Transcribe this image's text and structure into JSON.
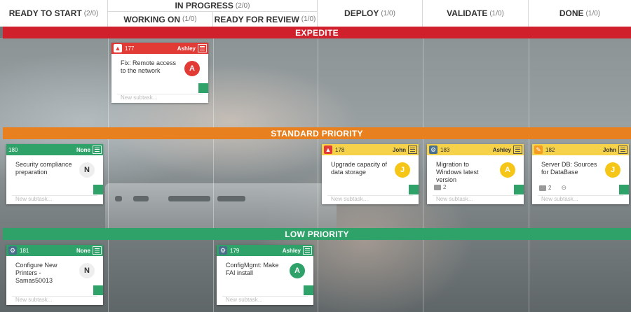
{
  "columns": [
    {
      "id": "ready",
      "label": "READY TO START",
      "count": "(2/0)"
    },
    {
      "id": "inprogress",
      "label": "IN PROGRESS",
      "count": "(2/0)"
    },
    {
      "id": "working",
      "label": "WORKING ON",
      "count": "(1/0)"
    },
    {
      "id": "review",
      "label": "READY FOR REVIEW",
      "count": "(1/0)"
    },
    {
      "id": "deploy",
      "label": "DEPLOY",
      "count": "(1/0)"
    },
    {
      "id": "validate",
      "label": "VALIDATE",
      "count": "(1/0)"
    },
    {
      "id": "done",
      "label": "DONE",
      "count": "(1/0)"
    }
  ],
  "lanes": {
    "expedite": {
      "label": "EXPEDITE",
      "color": "#d0202c"
    },
    "standard": {
      "label": "STANDARD PRIORITY",
      "color": "#e8801f"
    },
    "low": {
      "label": "LOW PRIORITY",
      "color": "#2fa26a"
    }
  },
  "subtask_placeholder": "New subtask...",
  "cards": {
    "c177": {
      "id": "177",
      "owner": "Ashley",
      "title": "Fix: Remote access to the network",
      "avatar": "A",
      "icon": "warning-icon",
      "bar_color": "#e23b35",
      "avatar_color": "#e23b35",
      "square_color": "#2fa26a"
    },
    "c180": {
      "id": "180",
      "owner": "None",
      "title": "Security compliance preparation",
      "avatar": "N",
      "icon": "",
      "bar_color": "#2fa26a",
      "avatar_color": "#eeeeee",
      "square_color": "#2fa26a"
    },
    "c178": {
      "id": "178",
      "owner": "John",
      "title": "Upgrade capacity of data storage",
      "avatar": "J",
      "icon": "warning-icon",
      "bar_color": "#f5d24a",
      "avatar_color": "#f5c518",
      "square_color": "#2fa26a"
    },
    "c183": {
      "id": "183",
      "owner": "Ashley",
      "title": "Migration to Windows latest version",
      "avatar": "A",
      "icon": "gear-icon",
      "bar_color": "#f5d24a",
      "avatar_color": "#f5c518",
      "square_color": "#2fa26a",
      "comments": "2"
    },
    "c182": {
      "id": "182",
      "owner": "John",
      "title": "Server DB: Sources for DataBase",
      "avatar": "J",
      "icon": "wrench-icon",
      "bar_color": "#f5d24a",
      "avatar_color": "#f5c518",
      "square_color": "#2fa26a",
      "comments": "2"
    },
    "c181": {
      "id": "181",
      "owner": "None",
      "title": "Configure New Printers - Samas50013",
      "avatar": "N",
      "icon": "gear-icon",
      "bar_color": "#2fa26a",
      "avatar_color": "#eeeeee",
      "square_color": "#2fa26a"
    },
    "c179": {
      "id": "179",
      "owner": "Ashley",
      "title": "ConfigMgmt: Make FAI install",
      "avatar": "A",
      "icon": "gear-icon",
      "bar_color": "#2fa26a",
      "avatar_color": "#2fa26a",
      "square_color": "#2fa26a"
    }
  }
}
